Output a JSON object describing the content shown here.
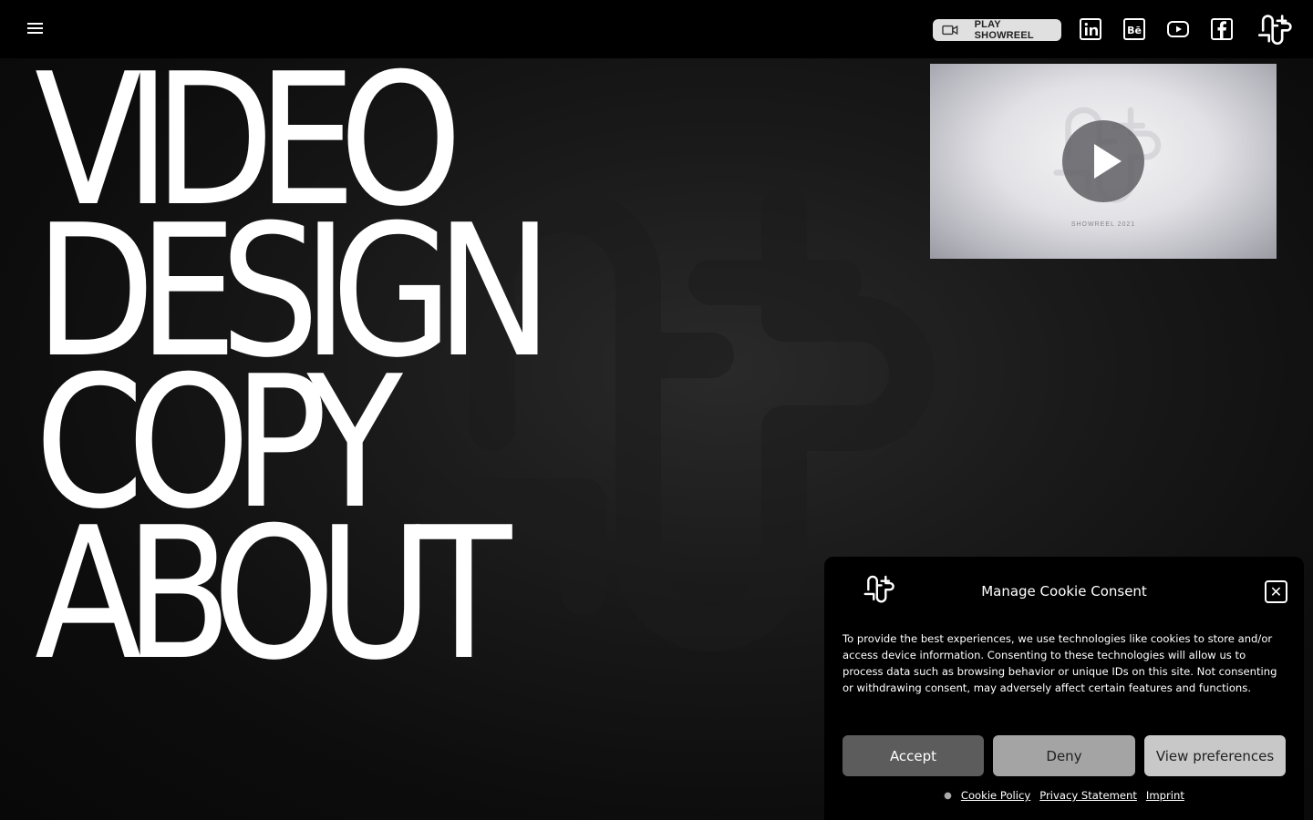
{
  "header": {
    "menu_icon": "hamburger-menu-icon",
    "showreel_label": "PLAY SHOWREEL",
    "showreel_icon": "video-camera-icon",
    "social": [
      {
        "name": "linkedin",
        "icon": "linkedin-icon",
        "glyph": "in"
      },
      {
        "name": "behance",
        "icon": "behance-icon",
        "glyph": "Bē"
      },
      {
        "name": "youtube",
        "icon": "youtube-icon",
        "glyph": ""
      },
      {
        "name": "facebook",
        "icon": "facebook-icon",
        "glyph": "f"
      }
    ],
    "logo_icon": "brand-logo-icon"
  },
  "nav": {
    "items": [
      "VIDEO",
      "DESIGN",
      "COPY",
      "ABOUT"
    ]
  },
  "video": {
    "caption": "SHOWREEL 2021",
    "play_icon": "play-icon"
  },
  "cookie": {
    "title": "Manage Cookie Consent",
    "text": "To provide the best experiences, we use technologies like cookies to store and/or access device information. Consenting to these technologies will allow us to process data such as browsing behavior or unique IDs on this site. Not consenting or withdrawing consent, may adversely affect certain features and functions.",
    "accept": "Accept",
    "deny": "Deny",
    "preferences": "View preferences",
    "links": [
      "Cookie Policy",
      "Privacy Statement",
      "Imprint"
    ],
    "close_icon": "close-icon"
  },
  "colors": {
    "background": "#111111",
    "header": "#000000",
    "accept_button": "#5c5c5c",
    "deny_button": "#a4a4a4",
    "preferences_button": "#c8c8c8"
  }
}
